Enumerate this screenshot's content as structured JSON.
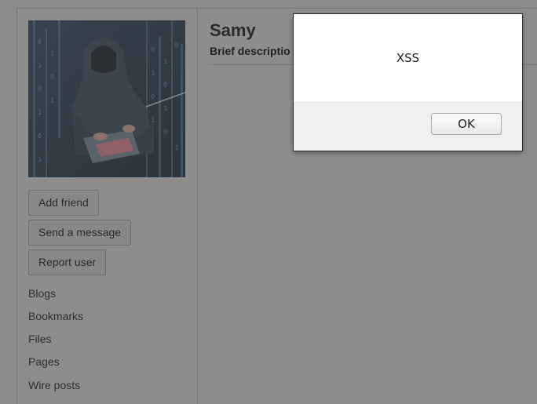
{
  "profile": {
    "name": "Samy",
    "brief_description": "Brief descriptio"
  },
  "sidebar": {
    "buttons": [
      {
        "label": "Add friend"
      },
      {
        "label": "Send a message"
      },
      {
        "label": "Report user"
      }
    ],
    "links": [
      {
        "label": "Blogs"
      },
      {
        "label": "Bookmarks"
      },
      {
        "label": "Files"
      },
      {
        "label": "Pages"
      },
      {
        "label": "Wire posts"
      }
    ]
  },
  "alert_dialog": {
    "message": "XSS",
    "ok_label": "OK"
  },
  "colors": {
    "overlay_background": "#8b8b8b",
    "dialog_background": "#ffffff",
    "dialog_footer": "#efefef"
  }
}
